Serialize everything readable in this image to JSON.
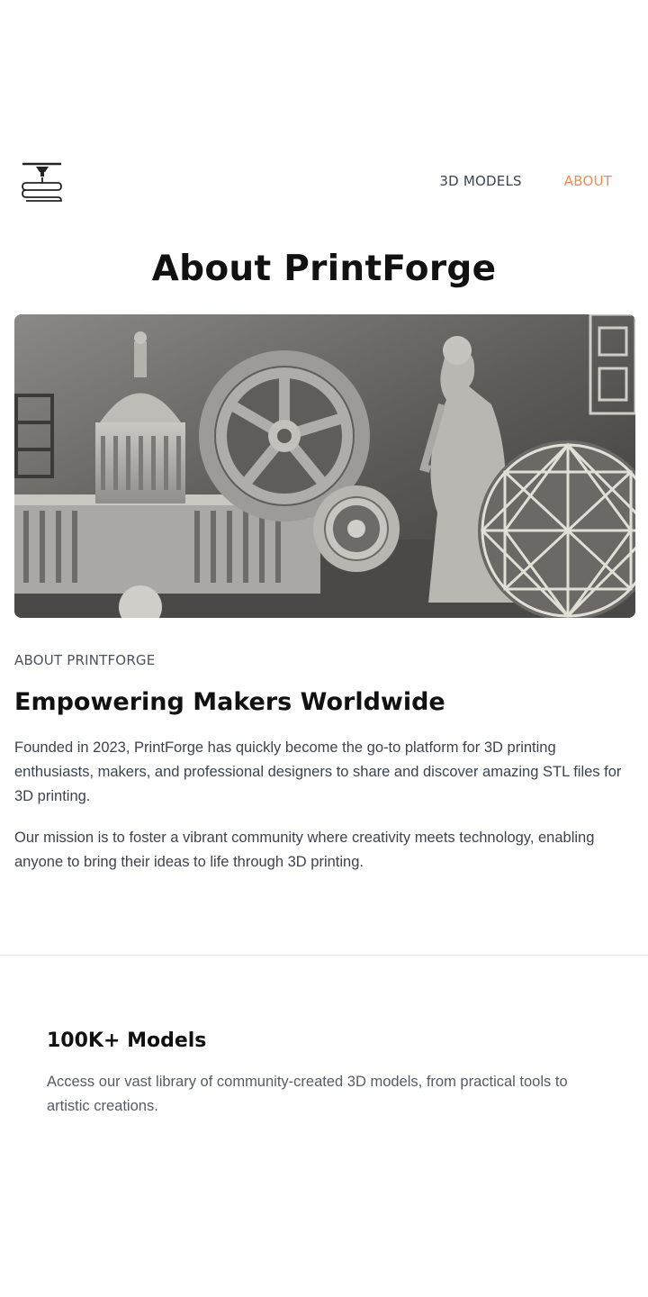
{
  "nav": {
    "items": [
      {
        "label": "3D MODELS",
        "active": false
      },
      {
        "label": "ABOUT",
        "active": true
      }
    ],
    "accent_color": "#ef8a55"
  },
  "logo": {
    "icon": "3d-printer-nozzle-icon"
  },
  "page_title": "About PrintForge",
  "hero_image": {
    "icon": "3d-printed-models-photo"
  },
  "about": {
    "eyebrow": "ABOUT PRINTFORGE",
    "title": "Empowering Makers Worldwide",
    "paragraphs": [
      "Founded in 2023, PrintForge has quickly become the go-to platform for 3D printing enthusiasts, makers, and professional designers to share and discover amazing STL files for 3D printing.",
      "Our mission is to foster a vibrant community where creativity meets technology, enabling anyone to bring their ideas to life through 3D printing."
    ]
  },
  "feature": {
    "title": "100K+ Models",
    "text": "Access our vast library of community-created 3D models, from practical tools to artistic creations."
  }
}
